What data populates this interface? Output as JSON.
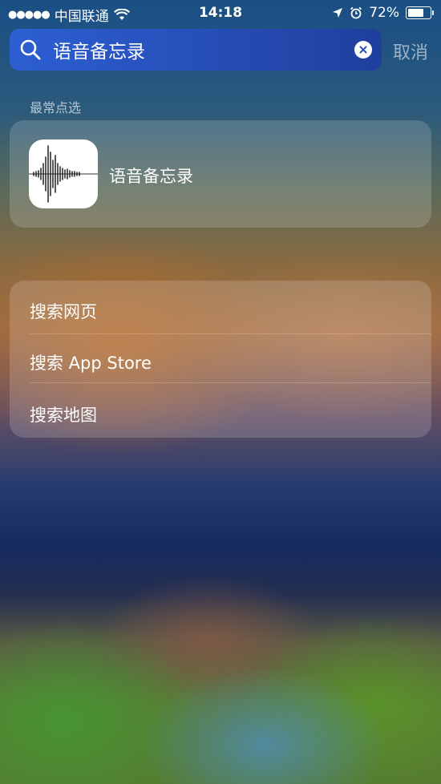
{
  "status_bar": {
    "signal_dots": "●●●●●",
    "carrier": "中国联通",
    "time": "14:18",
    "battery_percent": "72%",
    "battery_level": 0.72
  },
  "search": {
    "query": "语音备忘录",
    "cancel_label": "取消"
  },
  "top_hits": {
    "section_title": "最常点选",
    "app_name": "语音备忘录",
    "app_icon": "voice-memos-waveform"
  },
  "actions": [
    {
      "label": "搜索网页"
    },
    {
      "label": "搜索 App Store"
    },
    {
      "label": "搜索地图"
    }
  ],
  "colors": {
    "search_bar": "#2d5fd3",
    "cancel_text": "rgba(255,255,255,0.55)"
  }
}
